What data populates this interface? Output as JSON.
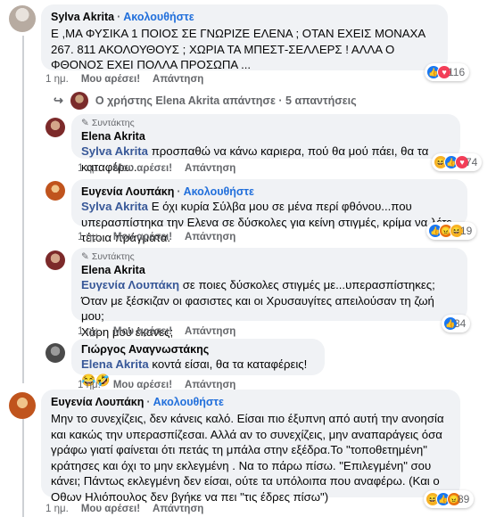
{
  "ui": {
    "follow_label": "Ακολουθήστε",
    "author_label": "Συντάκτης",
    "time": "1 ημ.",
    "like": "Μου αρέσει!",
    "reply": "Απάντηση",
    "dot": "·",
    "more": "..."
  },
  "comments": [
    {
      "name": "Sylva Akrita",
      "text": "Ε ,ΜΑ ΦΥΣΙΚΑ 1 ΠΟΙΟΣ ΣΕ ΓΝΩΡΙΖΕ ΕΛΕΝΑ ; ΟΤΑΝ ΕΧΕΙΣ ΜΟΝΑΧΑ 267. 811 ΑΚΟΛΟΥΘΟΥΣ ; ΧΩΡΙΑ ΤΑ ΜΠΕΣΤ-ΣΕΛΛΕΡΣ ! ΑΛΛΑ Ο ΦΘΟΝΟΣ ΕΧΕΙ ΠΟΛΛΑ ΠΡΟΣΩΠΑ ...",
      "reactions": [
        "like",
        "love"
      ],
      "count": "116"
    },
    {
      "name": "Elena Akrita",
      "mention": "Sylva Akrita",
      "text": "προσπαθώ να κάνω καριερα, πού θα μού πάει, θα τα καταφέρω.",
      "reactions": [
        "haha",
        "like",
        "love"
      ],
      "count": "74"
    },
    {
      "name": "Ευγενία Λουπάκη",
      "mention": "Sylva Akrita",
      "text": "Ε όχι κυρία Σύλβα μου σε μένα περί φθόνου...που υπερασπίστηκα την Ελενα σε δύσκολες για κείνη στιγμές, κρίμα να λέτε τέτοια πράγματα.",
      "reactions": [
        "like",
        "angry",
        "haha"
      ],
      "count": "19"
    },
    {
      "name": "Elena Akrita",
      "mention": "Ευγενία Λουπάκη",
      "text": "σε ποιες δύσκολες στιγμές με...υπερασπίστηκες; Όταν με ξέσκιζαν οι φασιστες και οι Χρυσαυγίτες απειλούσαν τη ζωή μου;",
      "text2": "Χάρη μού έκανες;",
      "reactions": [
        "like"
      ],
      "count": "34"
    },
    {
      "name": "Γιώργος Αναγνωστάκης",
      "mention": "Elena Akrita",
      "text": "κοντά είσαι, θα τα καταφέρεις! 😂🤣"
    },
    {
      "name": "Ευγενία Λουπάκη",
      "text": "Μην το συνεχίζεις, δεν κάνεις καλό. Είσαι πιο έξυπνη από αυτή την ανοησία και κακώς την υπερασπίζεσαι. Αλλά αν το συνεχίζεις, μην αναπαράγεις όσα γράφω γιατί φαίνεται ότι πετάς τη μπάλα στην εξέδρα.Το \"τοποθετημένη\" κράτησες και όχι το μην εκλεγμένη . Να το πάρω πίσω. \"Επιλεγμένη\" σου κάνει; Πάντως εκλεγμένη δεν είσαι, ούτε τα υπόλοιπα που αναφέρω. (Και ο Οθων Ηλιόπουλος δεν βγήκε να πει \"τις έδρες πίσω\")",
      "reactions": [
        "haha",
        "like",
        "angry"
      ],
      "count": "89"
    }
  ],
  "replies_link": "Ο χρήστης Elena Akrita απάντησε · 5 απαντήσεις",
  "colors": {
    "bubble": "#f0f2f5",
    "link": "#216fdb",
    "meta": "#65676b",
    "like": "#1877f2",
    "love": "#f33e58",
    "haha": "#f7b125",
    "angry": "#e9710f"
  }
}
